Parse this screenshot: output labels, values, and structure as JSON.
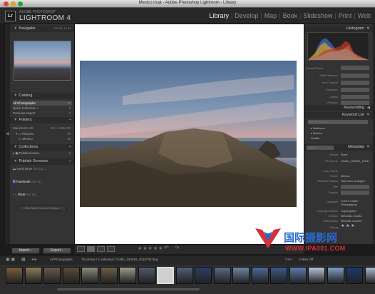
{
  "window": {
    "title": "Mexico.lrcat - Adobe Photoshop Lightroom - Library"
  },
  "identity": {
    "logo": "Lr",
    "subtitle": "ADOBE PHOTOSHOP",
    "name": "LIGHTROOM 4"
  },
  "modules": [
    {
      "label": "Library",
      "active": true
    },
    {
      "label": "Develop",
      "active": false
    },
    {
      "label": "Map",
      "active": false
    },
    {
      "label": "Book",
      "active": false
    },
    {
      "label": "Slideshow",
      "active": false
    },
    {
      "label": "Print",
      "active": false
    },
    {
      "label": "Web",
      "active": false
    }
  ],
  "left_panel": {
    "navigator": {
      "label": "Navigator",
      "zoom": "FIT FILL 1:1 3:1"
    },
    "catalog": {
      "label": "Catalog",
      "items": [
        {
          "label": "All Photographs",
          "count": "76"
        },
        {
          "label": "Quick Collection +",
          "count": "0"
        },
        {
          "label": "Previous Import",
          "count": "0"
        }
      ]
    },
    "folders": {
      "label": "Folders",
      "volume": {
        "label": "Macintosh HD",
        "info": "42.1 / 465 GB"
      },
      "items": [
        {
          "label": "Pictures",
          "count": "76"
        },
        {
          "label": "Mexico",
          "count": "76"
        }
      ]
    },
    "collections": {
      "label": "Collections",
      "items": [
        {
          "label": "Publicaciones",
          "count": "0"
        }
      ]
    },
    "publish_services": {
      "label": "Publish Services",
      "items": [
        {
          "label": "Hard Drive",
          "sub": "Set Up..."
        },
        {
          "label": "Facebook",
          "sub": "Set Up..."
        },
        {
          "label": "Flickr",
          "sub": "Set Up..."
        }
      ],
      "find_more": "Find More Services Online..."
    },
    "buttons": {
      "import": "Import...",
      "export": "Export..."
    }
  },
  "right_panel": {
    "histogram": {
      "label": "Histogram"
    },
    "quick_develop": {
      "preset_label": "Saved Preset",
      "rows": [
        "White Balance",
        "Tone Control",
        "Exposure",
        "Clarity",
        "Vibrance"
      ]
    },
    "keywording": {
      "label": "Keywording"
    },
    "keyword_list": {
      "label": "Keyword List",
      "filter_placeholder": "Filter Keywords",
      "items": [
        "Baltimore",
        "Mexico",
        "Seattle"
      ]
    },
    "metadata": {
      "label": "Metadata",
      "preset": "Default",
      "fields": [
        {
          "label": "Preset",
          "value": "None"
        },
        {
          "label": "File Name",
          "value": "Chalfo_130520_1019733.dng"
        },
        {
          "label": "Copy Name",
          "value": ""
        },
        {
          "label": "Folder",
          "value": "Mexico"
        },
        {
          "label": "Metadata Status",
          "value": "Has been changed"
        },
        {
          "label": "Title",
          "value": ""
        },
        {
          "label": "Caption",
          "value": ""
        },
        {
          "label": "Copyright",
          "value": "©2013 Chalfo Photography"
        },
        {
          "label": "Copyright Status",
          "value": "Copyrighted"
        },
        {
          "label": "Creator",
          "value": "Bernardo Chalfo"
        },
        {
          "label": "Sublocation",
          "value": "Mexcale Sunrise"
        },
        {
          "label": "Rating",
          "value": "★ ★ ★"
        }
      ]
    }
  },
  "toolbar": {
    "rating": "★★★★★"
  },
  "filmstrip": {
    "source": "All Photographs",
    "status": "76 photos / 1 selected / Chalfo_130520_1019733.dng",
    "filter_label": "Filter :",
    "filter_value": "Filters Off",
    "selected_index": 8,
    "thumb_colors": [
      "#7b5c3c",
      "#8a7c5c",
      "#6a5a48",
      "#5b4a3a",
      "#8a8a7a",
      "#6d5c45",
      "#9a9a90",
      "#4e5a6a",
      "#cccccc",
      "#4f5f7a",
      "#2c3e66",
      "#5a6a84",
      "#6f86a6",
      "#4a6a9a",
      "#3a5a8a",
      "#5c7caf",
      "#b6c4d9",
      "#7f9dc2",
      "#1f3870",
      "#a8b8cf"
    ]
  },
  "watermark": {
    "cn": "国际摄影网",
    "url": "WWW.IPA001.COM"
  },
  "colors": {
    "accent_red": "#e0443e",
    "watermark_red": "#d6303a",
    "watermark_blue": "#1f6fc8"
  }
}
